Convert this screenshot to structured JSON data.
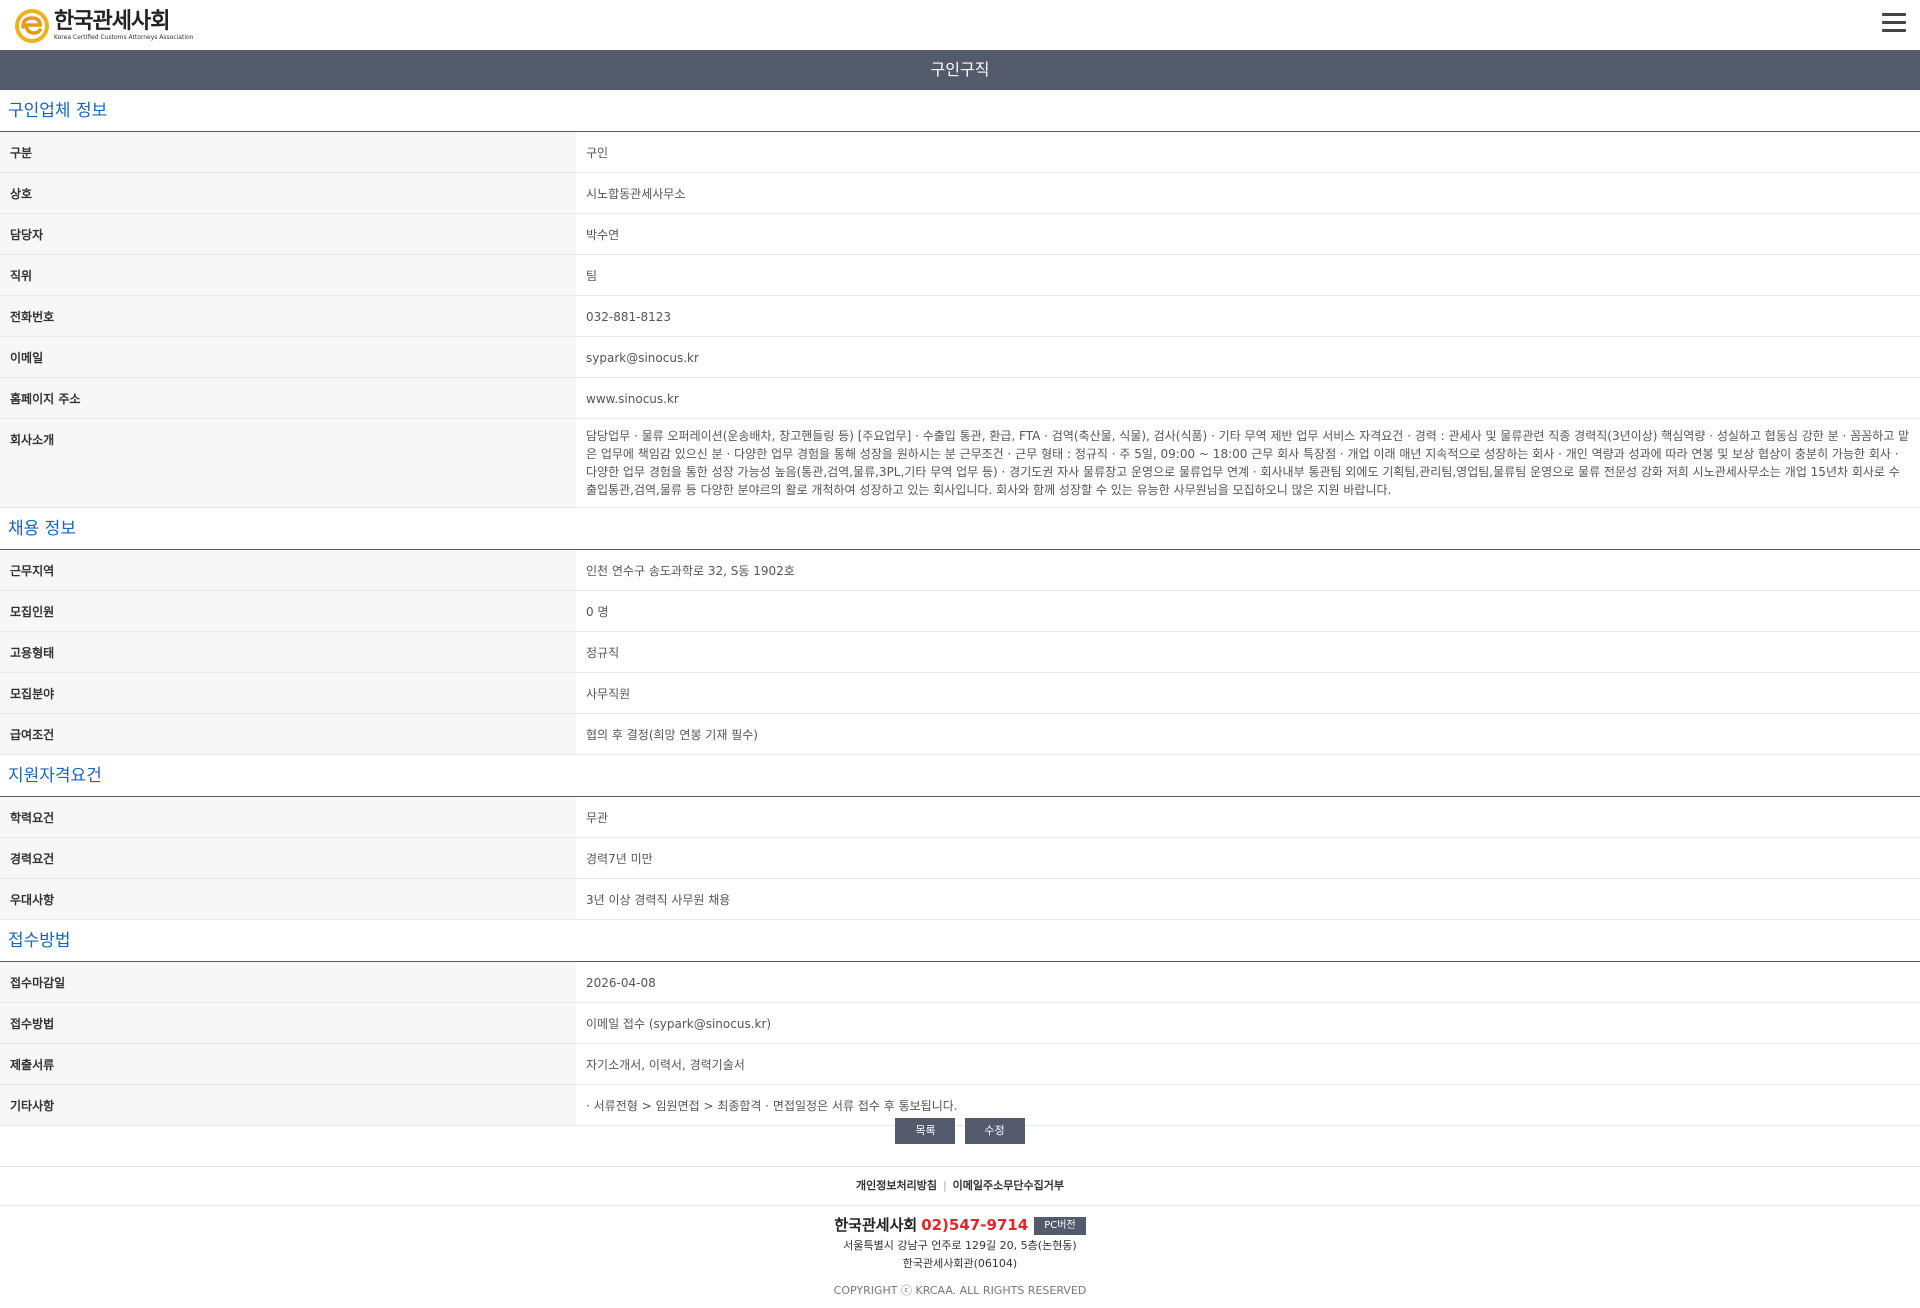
{
  "header": {
    "logo_kor": "한국관세사회",
    "logo_eng": "Korea Certified Customs Attorneys Association",
    "menu_icon": "hamburger-menu-icon",
    "page_title": "구인구직"
  },
  "sections": {
    "company": {
      "title": "구인업체 정보",
      "rows": [
        {
          "label": "구분",
          "value": "구인"
        },
        {
          "label": "상호",
          "value": "시노합동관세사무소"
        },
        {
          "label": "담당자",
          "value": "박수연"
        },
        {
          "label": "직위",
          "value": "팀"
        },
        {
          "label": "전화번호",
          "value": "032-881-8123"
        },
        {
          "label": "이메일",
          "value": "sypark@sinocus.kr"
        },
        {
          "label": "홈페이지 주소",
          "value": "www.sinocus.kr"
        },
        {
          "label": "회사소개",
          "value": "담당업무 · 물류 오퍼레이션(운송배차, 창고핸들링 등) [주요업무] · 수출입 통관, 환급, FTA · 검역(축산물, 식물), 검사(식품) · 기타 무역 제반 업무 서비스 자격요건 · 경력 : 관세사 및 물류관련 직종 경력직(3년이상) 핵심역량 · 성실하고 협동심 강한 분 · 꼼꼼하고 맡은 업무에 책임감 있으신 분 · 다양한 업무 경험을 통해 성장을 원하시는 분 근무조건 · 근무 형태 : 정규직 · 주 5일, 09:00 ~ 18:00 근무 회사 특장점 · 개업 이래 매년 지속적으로 성장하는 회사 · 개인 역량과 성과에 따라 연봉 및 보상 협상이 충분히 가능한 회사 · 다양한 업무 경험을 통한 성장 가능성 높음(통관,검역,물류,3PL,기타 무역 업무 등) · 경기도권 자사 물류창고 운영으로 물류업무 연계 · 회사내부 통관팀 외에도 기획팀,관리팀,영업팀,물류팀 운영으로 물류 전문성 강화 저희 시노관세사무소는 개업 15년차 회사로 수출입통관,검역,물류 등 다양한 분야르의 활로 개척하여 성장하고 있는 회사입니다. 회사와 함께 성장할 수 있는 유능한 사무원님을 모집하오니 많은 지원 바랍니다."
        }
      ]
    },
    "recruit": {
      "title": "채용 정보",
      "rows": [
        {
          "label": "근무지역",
          "value": "인천 연수구 송도과학로 32, S동 1902호"
        },
        {
          "label": "모집인원",
          "value": "0 명"
        },
        {
          "label": "고용형태",
          "value": "정규직"
        },
        {
          "label": "모집분야",
          "value": "사무직원"
        },
        {
          "label": "급여조건",
          "value": "협의 후 결정(희망 연봉 기재 필수)"
        }
      ]
    },
    "qualification": {
      "title": "지원자격요건",
      "rows": [
        {
          "label": "학력요건",
          "value": "무관"
        },
        {
          "label": "경력요건",
          "value": "경력7년 미만"
        },
        {
          "label": "우대사항",
          "value": "3년 이상 경력직 사무원 채용"
        }
      ]
    },
    "apply": {
      "title": "접수방법",
      "rows": [
        {
          "label": "접수마감일",
          "value": "2026-04-08"
        },
        {
          "label": "접수방법",
          "value": "이메일 접수 (sypark@sinocus.kr)"
        },
        {
          "label": "제출서류",
          "value": "자기소개서, 이력서, 경력기술서"
        },
        {
          "label": "기타사항",
          "value": " · 서류전형 > 임원면접 > 최종합격 · 면접일정은 서류 접수 후 통보됩니다."
        }
      ]
    }
  },
  "buttons": {
    "list": "목록",
    "edit": "수정"
  },
  "footer": {
    "link_privacy": "개인정보처리방침",
    "link_email": "이메일주소무단수집거부",
    "org": "한국관세사회",
    "phone": "02)547-9714",
    "pc_version": "PC버전",
    "address1": "서울특별시 강남구 언주로 129길 20, 5층(논현동)",
    "address2": "한국관세사회관(06104)",
    "copyright": "COPYRIGHT ⓒ KRCAA. ALL RIGHTS RESERVED"
  },
  "colors": {
    "bar": "#535a6b",
    "section_title": "#1a66b3",
    "phone": "#e8242a"
  }
}
